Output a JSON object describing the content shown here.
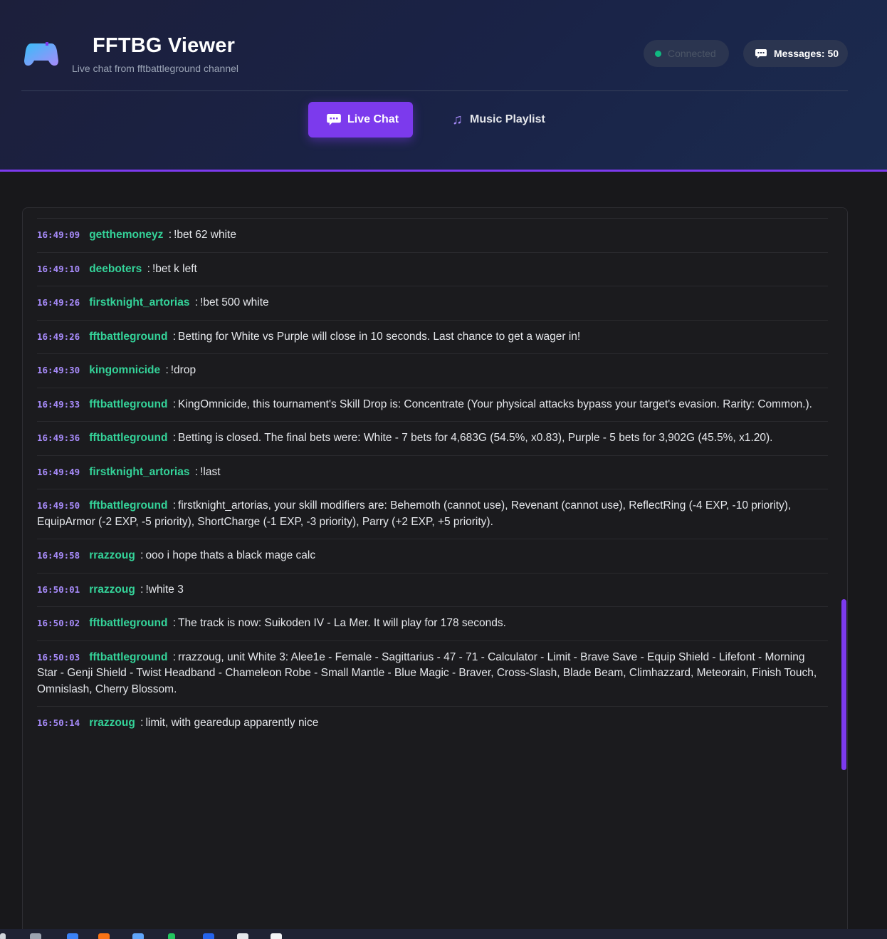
{
  "app": {
    "title": "FFTBG Viewer",
    "subtitle": "Live chat from fftbattleground channel",
    "logo_icon": "gamepad-icon"
  },
  "status": {
    "label": "Connected",
    "color": "#10b981"
  },
  "counter": {
    "label": "Messages: 50",
    "icon": "chat-bubble-icon"
  },
  "tabs": [
    {
      "label": "Live Chat",
      "icon": "chat-bubble-icon",
      "active": true
    },
    {
      "label": "Music Playlist",
      "icon": "music-note-icon",
      "active": false
    }
  ],
  "colors": {
    "accent": "#7c3aed",
    "username": "#34d399",
    "timestamp": "#a78bfa"
  },
  "messages": [
    {
      "time": "16:49:09",
      "user": "getthemoneyz",
      "text": "!bet 62 white"
    },
    {
      "time": "16:49:10",
      "user": "deeboters",
      "text": "!bet k left"
    },
    {
      "time": "16:49:26",
      "user": "firstknight_artorias",
      "text": "!bet 500 white"
    },
    {
      "time": "16:49:26",
      "user": "fftbattleground",
      "text": "Betting for White vs Purple will close in 10 seconds. Last chance to get a wager in!"
    },
    {
      "time": "16:49:30",
      "user": "kingomnicide",
      "text": "!drop"
    },
    {
      "time": "16:49:33",
      "user": "fftbattleground",
      "text": "KingOmnicide, this tournament's Skill Drop is: Concentrate (Your physical attacks bypass your target's evasion. Rarity: Common.)."
    },
    {
      "time": "16:49:36",
      "user": "fftbattleground",
      "text": "Betting is closed. The final bets were: White - 7 bets for 4,683G (54.5%, x0.83), Purple - 5 bets for 3,902G (45.5%, x1.20)."
    },
    {
      "time": "16:49:49",
      "user": "firstknight_artorias",
      "text": "!last"
    },
    {
      "time": "16:49:50",
      "user": "fftbattleground",
      "text": "firstknight_artorias, your skill modifiers are: Behemoth (cannot use), Revenant (cannot use), ReflectRing (-4 EXP, -10 priority), EquipArmor (-2 EXP, -5 priority), ShortCharge (-1 EXP, -3 priority), Parry (+2 EXP, +5 priority)."
    },
    {
      "time": "16:49:58",
      "user": "rrazzoug",
      "text": "ooo i hope thats a black mage calc"
    },
    {
      "time": "16:50:01",
      "user": "rrazzoug",
      "text": "!white 3"
    },
    {
      "time": "16:50:02",
      "user": "fftbattleground",
      "text": "The track is now: Suikoden IV - La Mer. It will play for 178 seconds."
    },
    {
      "time": "16:50:03",
      "user": "fftbattleground",
      "text": "rrazzoug, unit White 3: Alee1e - Female - Sagittarius - 47 - 71 - Calculator - Limit - Brave Save - Equip Shield - Lifefont - Morning Star - Genji Shield - Twist Headband - Chameleon Robe - Small Mantle - Blue Magic - Braver, Cross-Slash, Blade Beam, Climhazzard, Meteorain, Finish Touch, Omnislash, Cherry Blossom."
    },
    {
      "time": "16:50:14",
      "user": "rrazzoug",
      "text": "limit, with gearedup apparently nice"
    }
  ]
}
